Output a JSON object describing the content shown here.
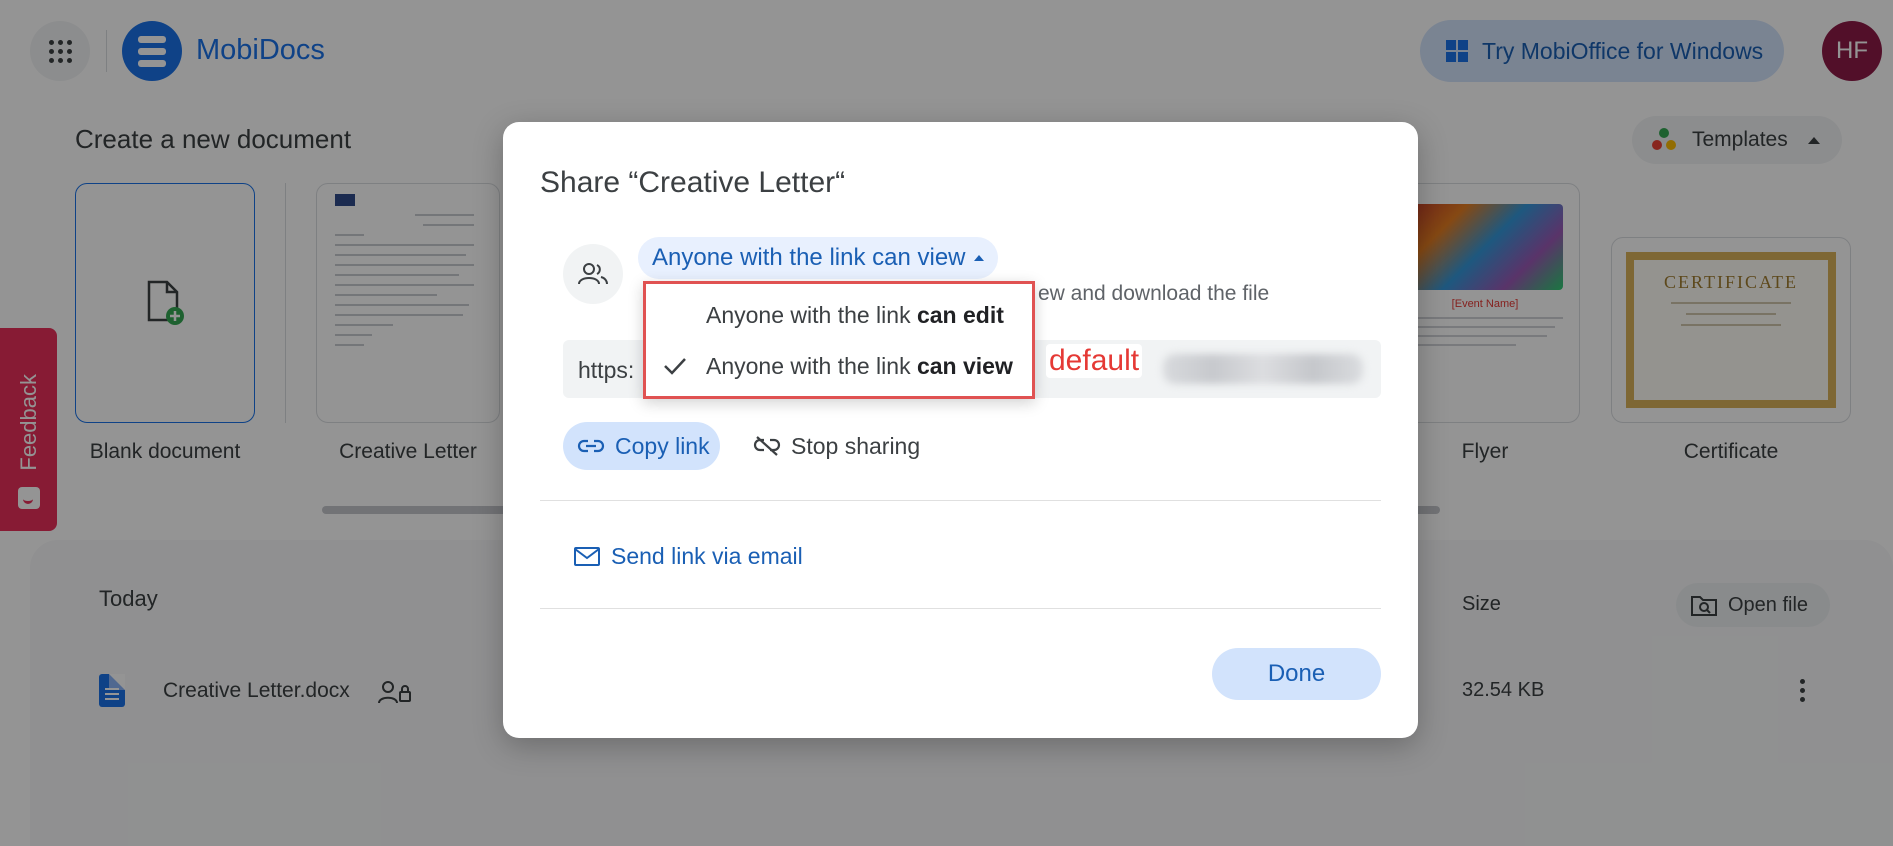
{
  "app": {
    "name": "MobiDocs",
    "try_label": "Try MobiOffice for Windows",
    "avatar_initials": "HF",
    "accent": "#1a73e8"
  },
  "create": {
    "title": "Create a new document",
    "templates_label": "Templates",
    "cards": [
      {
        "label": "Blank document"
      },
      {
        "label": "Creative Letter"
      },
      {
        "label": "Flyer",
        "preview_title": "[Event Name]"
      },
      {
        "label": "Certificate",
        "preview_title": "CERTIFICATE"
      }
    ]
  },
  "files": {
    "section": "Today",
    "size_header": "Size",
    "open_file_label": "Open file",
    "rows": [
      {
        "name": "Creative Letter.docx",
        "size": "32.54 KB"
      }
    ]
  },
  "feedback": {
    "label": "Feedback",
    "color": "#e8305a"
  },
  "modal": {
    "title": "Share “Creative Letter“",
    "access_label": "Anyone with the link can view",
    "access_description": "ew and download the file",
    "link_prefix": "https:",
    "link_colon": ":",
    "copy_label": "Copy link",
    "stop_label": "Stop sharing",
    "email_label": "Send link via email",
    "done_label": "Done"
  },
  "dropdown": {
    "items": [
      {
        "prefix": "Anyone with the link ",
        "emphasis": "can edit",
        "selected": false
      },
      {
        "prefix": "Anyone with the link ",
        "emphasis": "can view",
        "selected": true
      }
    ],
    "border_color": "#e05252"
  },
  "annotation": {
    "text": "default",
    "color": "#e53935"
  }
}
